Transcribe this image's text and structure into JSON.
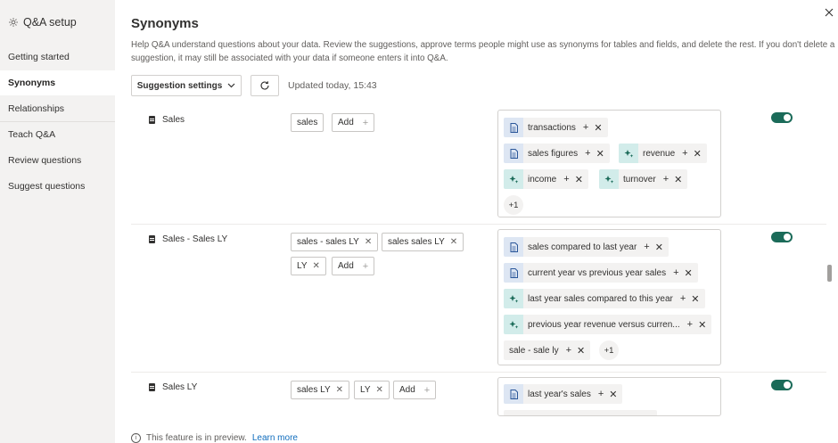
{
  "sidebar": {
    "title": "Q&A setup",
    "items": [
      {
        "label": "Getting started"
      },
      {
        "label": "Synonyms"
      },
      {
        "label": "Relationships"
      },
      {
        "label": "Teach Q&A"
      },
      {
        "label": "Review questions"
      },
      {
        "label": "Suggest questions"
      }
    ]
  },
  "header": {
    "title": "Synonyms",
    "description": "Help Q&A understand questions about your data. Review the suggestions, approve terms people might use as synonyms for tables and fields, and delete the rest. If you don't delete a suggestion, it may still be associated with your data if someone enters it into Q&A.",
    "suggestion_settings": "Suggestion settings",
    "updated": "Updated today, 15:43"
  },
  "add_label": "Add",
  "rows": [
    {
      "name": "Sales",
      "terms": [
        "sales"
      ],
      "suggestions": [
        {
          "text": "transactions",
          "icon": "doc"
        },
        {
          "text": "sales figures",
          "icon": "doc"
        },
        {
          "text": "revenue",
          "icon": "ai"
        },
        {
          "text": "income",
          "icon": "ai"
        },
        {
          "text": "turnover",
          "icon": "ai"
        }
      ],
      "more": "+1",
      "enabled": true
    },
    {
      "name": "Sales - Sales LY",
      "terms": [
        "sales - sales LY",
        "sales sales LY",
        "LY"
      ],
      "suggestions": [
        {
          "text": "sales compared to last year",
          "icon": "doc"
        },
        {
          "text": "current year vs previous year sales",
          "icon": "doc"
        },
        {
          "text": "last year sales compared to this year",
          "icon": "ai"
        },
        {
          "text": "previous year revenue versus curren...",
          "icon": "ai"
        },
        {
          "text": "sale - sale ly",
          "icon": "none"
        }
      ],
      "more": "+1",
      "enabled": true
    },
    {
      "name": "Sales LY",
      "terms": [
        "sales LY",
        "LY"
      ],
      "suggestions": [
        {
          "text": "last year's sales",
          "icon": "doc"
        }
      ],
      "enabled": true
    }
  ],
  "footer": {
    "note": "This feature is in preview.",
    "link": "Learn more"
  }
}
